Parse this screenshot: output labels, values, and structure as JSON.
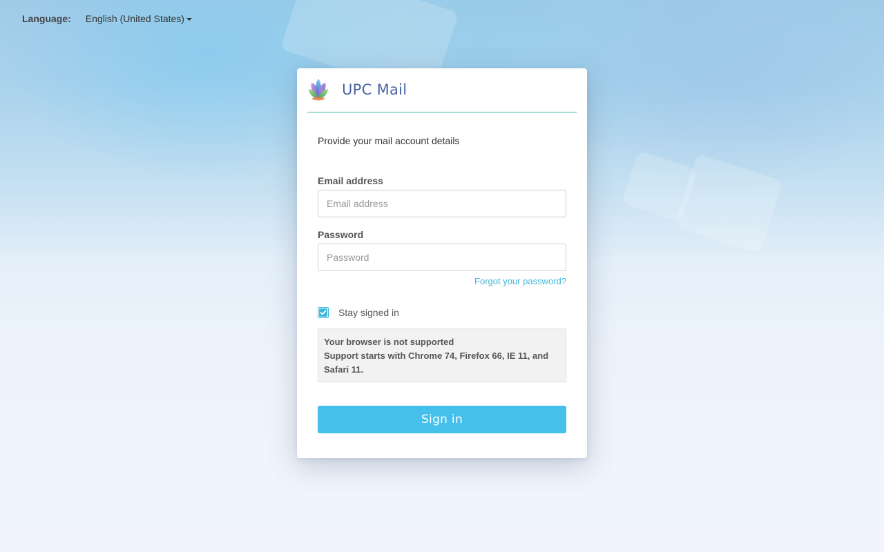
{
  "language": {
    "label": "Language:",
    "selected": "English (United States)"
  },
  "brand": {
    "title": "UPC Mail",
    "logo_icon": "upc-logo-icon"
  },
  "form": {
    "intro": "Provide your mail account details",
    "email_label": "Email address",
    "email_placeholder": "Email address",
    "email_value": "",
    "password_label": "Password",
    "password_placeholder": "Password",
    "password_value": "",
    "forgot_link": "Forgot your password?",
    "stay_signed_in_label": "Stay signed in",
    "stay_signed_in_checked": true,
    "warning_title": "Your browser is not supported",
    "warning_body": "Support starts with Chrome 74, Firefox 66, IE 11, and Safari 11.",
    "signin_label": "Sign in"
  },
  "colors": {
    "accent": "#45c0ea",
    "link": "#3fb7d8",
    "title": "#4a64a8",
    "divider": "#3ab5a8"
  }
}
